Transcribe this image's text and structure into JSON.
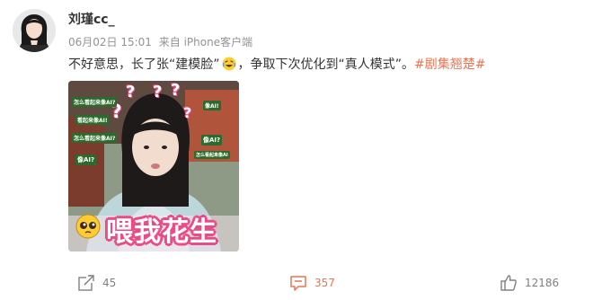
{
  "post": {
    "username": "刘瑾cc_",
    "date": "06月02日 15:01",
    "source": "来自 iPhone客户端",
    "content_part1": "不好意思，长了张“建模脸”",
    "content_part2": "，争取下次优化到“真人模式”。",
    "hashtag": "#剧集翘楚#",
    "emoji_icon": "laughing-tears-emoji",
    "media": {
      "caption": "喂我花生",
      "sticker_icon": "pleading-face-emoji",
      "question_marks": [
        "?",
        "?",
        "?",
        "?",
        "?"
      ],
      "annotation_labels": [
        "怎么看起来像AI?",
        "看起来像AI!",
        "怎么看起来像AI?",
        "像AI?",
        "像AI!",
        "像AI?",
        "怎么看起来像AI"
      ]
    }
  },
  "actions": {
    "share_count": "45",
    "comment_count": "357",
    "like_count": "12186"
  },
  "colors": {
    "accent": "#eb7350",
    "meta_text": "#939393",
    "caption_pink": "#e94c86"
  }
}
